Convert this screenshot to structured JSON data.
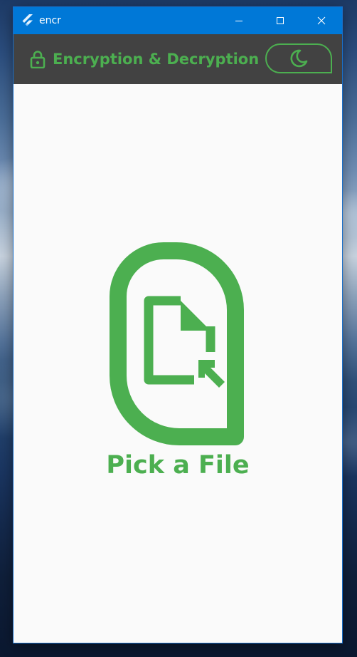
{
  "window": {
    "title": "encr",
    "app_icon": "flutter-logo-icon",
    "controls": {
      "minimize_icon": "minimize-icon",
      "maximize_icon": "maximize-icon",
      "close_icon": "close-icon"
    }
  },
  "appbar": {
    "title": "Encryption & Decryption",
    "title_icon": "lock-icon",
    "theme_toggle_icon": "moon-icon",
    "background_color": "#424242",
    "accent_color": "#4caf50"
  },
  "main": {
    "picker_icon": "file-pick-icon",
    "pick_label": "Pick a File"
  },
  "colors": {
    "titlebar": "#0078d7",
    "content_background": "#fafafa",
    "accent": "#4caf50"
  }
}
